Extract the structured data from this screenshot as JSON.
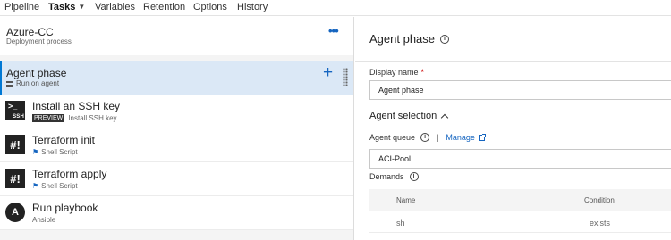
{
  "tabs": [
    {
      "label": "Pipeline"
    },
    {
      "label": "Tasks"
    },
    {
      "label": "Variables"
    },
    {
      "label": "Retention"
    },
    {
      "label": "Options"
    },
    {
      "label": "History"
    }
  ],
  "process": {
    "title": "Azure-CC",
    "subtitle": "Deployment process",
    "more_label": "•••"
  },
  "phase": {
    "title": "Agent phase",
    "subtitle": "Run on agent",
    "add_label": "+"
  },
  "tasks": [
    {
      "title": "Install an SSH key",
      "badge": "PREVIEW",
      "subtitle": "Install SSH key",
      "icon": "ssh-key-icon",
      "icon_text": "SSH"
    },
    {
      "title": "Terraform init",
      "subtitle": "Shell Script",
      "icon": "shell-script-icon",
      "icon_text": "#!"
    },
    {
      "title": "Terraform apply",
      "subtitle": "Shell Script",
      "icon": "shell-script-icon",
      "icon_text": "#!"
    },
    {
      "title": "Run playbook",
      "subtitle": "Ansible",
      "icon": "ansible-icon",
      "icon_text": "A"
    }
  ],
  "detail": {
    "title": "Agent phase",
    "display_name_label": "Display name",
    "required_mark": "*",
    "display_name_value": "Agent phase",
    "agent_selection_label": "Agent selection",
    "agent_queue_label": "Agent queue",
    "separator": "|",
    "manage_label": "Manage",
    "agent_queue_value": "ACI-Pool",
    "demands_label": "Demands",
    "demands_columns": {
      "name": "Name",
      "condition": "Condition"
    },
    "demands_rows": [
      {
        "name": "sh",
        "condition": "exists"
      }
    ]
  },
  "colors": {
    "accent": "#0078d4",
    "link": "#1565c0",
    "selected_row": "#dbe8f6"
  }
}
